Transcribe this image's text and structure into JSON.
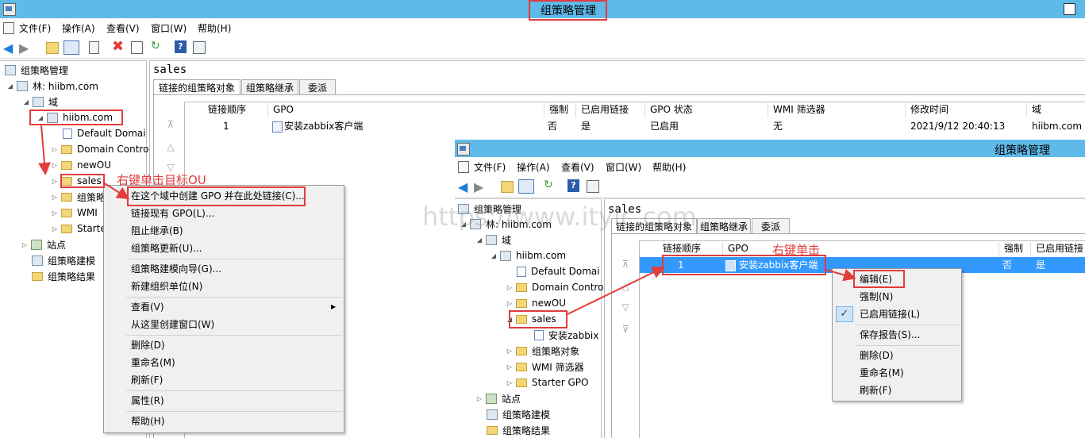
{
  "left_window": {
    "title": "组策略管理",
    "menu": [
      "文件(F)",
      "操作(A)",
      "查看(V)",
      "窗口(W)",
      "帮助(H)"
    ],
    "tree": {
      "root": "组策略管理",
      "forest": "林: hiibm.com",
      "domains": "域",
      "domain": "hiibm.com",
      "children": [
        "Default Domai",
        "Domain Contro",
        "newOU",
        "sales",
        "组策略",
        "WMI",
        "Starte"
      ],
      "sites": "站点",
      "modeling": "组策略建模",
      "results": "组策略结果"
    },
    "details": {
      "heading": "sales",
      "tabs": [
        "链接的组策略对象",
        "组策略继承",
        "委派"
      ],
      "columns": [
        "链接顺序",
        "GPO",
        "强制",
        "已启用链接",
        "GPO 状态",
        "WMI 筛选器",
        "修改时间",
        "域"
      ],
      "row": [
        "1",
        "安装zabbix客户端",
        "否",
        "是",
        "已启用",
        "无",
        "2021/9/12 20:40:13",
        "hiibm.com"
      ]
    },
    "context_menu": {
      "items": [
        "在这个域中创建 GPO 并在此处链接(C)...",
        "链接现有 GPO(L)...",
        "阻止继承(B)",
        "组策略更新(U)...",
        "组策略建模向导(G)...",
        "新建组织单位(N)",
        "查看(V)",
        "从这里创建窗口(W)",
        "删除(D)",
        "重命名(M)",
        "刷新(F)",
        "属性(R)",
        "帮助(H)"
      ]
    },
    "annotation": "右键单击目标OU"
  },
  "right_window": {
    "title": "组策略管理",
    "menu": [
      "文件(F)",
      "操作(A)",
      "查看(V)",
      "窗口(W)",
      "帮助(H)"
    ],
    "tree": {
      "root": "组策略管理",
      "forest": "林: hiibm.com",
      "domains": "域",
      "domain": "hiibm.com",
      "children": [
        "Default Domai",
        "Domain Contro",
        "newOU",
        "sales",
        "安装zabbix",
        "组策略对象",
        "WMI 筛选器",
        "Starter GPO"
      ],
      "sites": "站点",
      "modeling": "组策略建模",
      "results": "组策略结果"
    },
    "details": {
      "heading": "sales",
      "tabs": [
        "链接的组策略对象",
        "组策略继承",
        "委派"
      ],
      "columns": [
        "链接顺序",
        "GPO",
        "强制",
        "已启用链接"
      ],
      "row": [
        "1",
        "安装zabbix客户端",
        "否",
        "是"
      ]
    },
    "context_menu": {
      "items": [
        "编辑(E)",
        "强制(N)",
        "已启用链接(L)",
        "保存报告(S)...",
        "删除(D)",
        "重命名(M)",
        "刷新(F)"
      ],
      "checked_item": "已启用链接(L)"
    },
    "annotation": "右键单击"
  },
  "watermark": "https://www.itylc.com",
  "colors": {
    "titlebar": "#5fb9e9",
    "selection": "#3399ff",
    "annotation": "#e23c3c"
  }
}
